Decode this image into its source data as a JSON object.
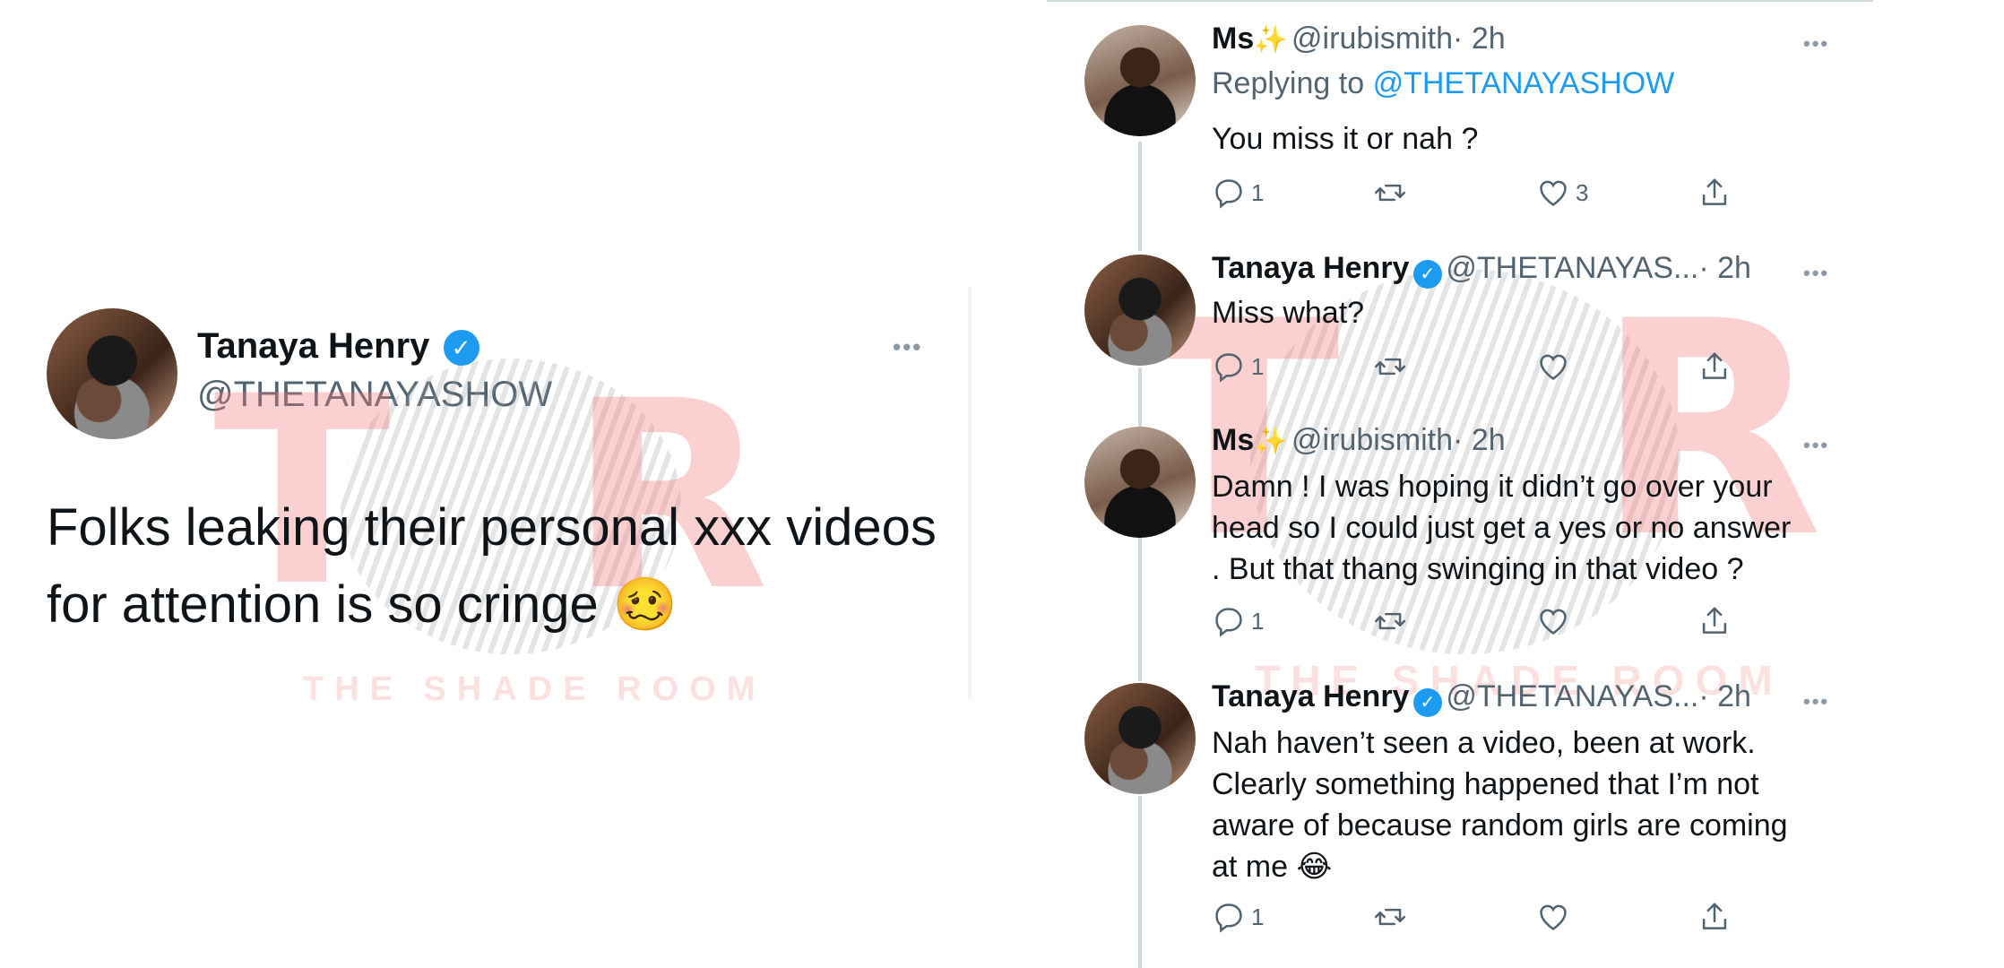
{
  "main_tweet": {
    "name": "Tanaya Henry",
    "handle": "@THETANAYASHOW",
    "text": "Folks leaking their personal xxx videos for attention is so cringe",
    "emoji": "🥴",
    "more": "•••"
  },
  "watermark": {
    "letter_left": "T",
    "letter_right": "R",
    "brand": "THE SHADE ROOM"
  },
  "replies": [
    {
      "name": "Ms",
      "sparkle": "✨",
      "handle": "@irubismith",
      "time": "· 2h",
      "replying_prefix": "Replying to",
      "replying_to": "@THETANAYASHOW",
      "text": "You miss it or nah ?",
      "reply_count": "1",
      "like_count": "3",
      "more": "•••"
    },
    {
      "name": "Tanaya Henry",
      "handle": "@THETANAYAS...",
      "time": "· 2h",
      "text": "Miss what?",
      "reply_count": "1",
      "more": "•••"
    },
    {
      "name": "Ms",
      "sparkle": "✨",
      "handle": "@irubismith",
      "time": "· 2h",
      "text_lines": [
        "Damn ! I was hoping it didn’t go over your",
        "head so I could just get a yes or no answer",
        ". But that thang swinging in that video ?"
      ],
      "reply_count": "1",
      "more": "•••"
    },
    {
      "name": "Tanaya Henry",
      "handle": "@THETANAYAS...",
      "time": "· 2h",
      "text_lines": [
        "Nah haven’t seen a video, been at work.",
        "Clearly something happened that I’m not",
        "aware of because random girls are coming",
        "at me"
      ],
      "emoji": "😂",
      "reply_count": "1",
      "more": "•••"
    }
  ],
  "icons": [
    "reply-icon",
    "retweet-icon",
    "like-icon",
    "share-icon",
    "verified-icon",
    "more-icon"
  ],
  "colors": {
    "link": "#1d9bf0",
    "muted": "#536471",
    "watermark": "#f27878"
  }
}
